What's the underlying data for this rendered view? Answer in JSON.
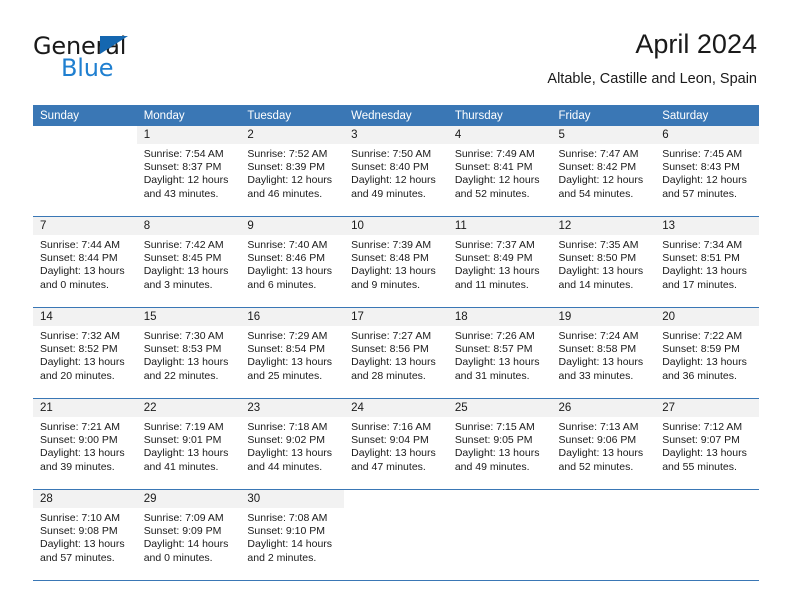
{
  "logo": {
    "word_one": "General",
    "word_two": "Blue",
    "triangle_color": "#1567b0",
    "blue_color": "#1f7fd0"
  },
  "header": {
    "title": "April 2024",
    "subtitle": "Altable, Castille and Leon, Spain"
  },
  "theme": {
    "header_band": "#3a77b5",
    "daynum_band": "#f2f2f2",
    "text": "#1a1a1a"
  },
  "calendar": {
    "weekday_headers": [
      "Sunday",
      "Monday",
      "Tuesday",
      "Wednesday",
      "Thursday",
      "Friday",
      "Saturday"
    ],
    "labels": {
      "sunrise": "Sunrise:",
      "sunset": "Sunset:",
      "daylight": "Daylight:"
    },
    "weeks": [
      [
        {
          "day": "",
          "blank": true
        },
        {
          "day": "1",
          "sunrise": "Sunrise: 7:54 AM",
          "sunset": "Sunset: 8:37 PM",
          "daylight_1": "Daylight: 12 hours",
          "daylight_2": "and 43 minutes."
        },
        {
          "day": "2",
          "sunrise": "Sunrise: 7:52 AM",
          "sunset": "Sunset: 8:39 PM",
          "daylight_1": "Daylight: 12 hours",
          "daylight_2": "and 46 minutes."
        },
        {
          "day": "3",
          "sunrise": "Sunrise: 7:50 AM",
          "sunset": "Sunset: 8:40 PM",
          "daylight_1": "Daylight: 12 hours",
          "daylight_2": "and 49 minutes."
        },
        {
          "day": "4",
          "sunrise": "Sunrise: 7:49 AM",
          "sunset": "Sunset: 8:41 PM",
          "daylight_1": "Daylight: 12 hours",
          "daylight_2": "and 52 minutes."
        },
        {
          "day": "5",
          "sunrise": "Sunrise: 7:47 AM",
          "sunset": "Sunset: 8:42 PM",
          "daylight_1": "Daylight: 12 hours",
          "daylight_2": "and 54 minutes."
        },
        {
          "day": "6",
          "sunrise": "Sunrise: 7:45 AM",
          "sunset": "Sunset: 8:43 PM",
          "daylight_1": "Daylight: 12 hours",
          "daylight_2": "and 57 minutes."
        }
      ],
      [
        {
          "day": "7",
          "sunrise": "Sunrise: 7:44 AM",
          "sunset": "Sunset: 8:44 PM",
          "daylight_1": "Daylight: 13 hours",
          "daylight_2": "and 0 minutes."
        },
        {
          "day": "8",
          "sunrise": "Sunrise: 7:42 AM",
          "sunset": "Sunset: 8:45 PM",
          "daylight_1": "Daylight: 13 hours",
          "daylight_2": "and 3 minutes."
        },
        {
          "day": "9",
          "sunrise": "Sunrise: 7:40 AM",
          "sunset": "Sunset: 8:46 PM",
          "daylight_1": "Daylight: 13 hours",
          "daylight_2": "and 6 minutes."
        },
        {
          "day": "10",
          "sunrise": "Sunrise: 7:39 AM",
          "sunset": "Sunset: 8:48 PM",
          "daylight_1": "Daylight: 13 hours",
          "daylight_2": "and 9 minutes."
        },
        {
          "day": "11",
          "sunrise": "Sunrise: 7:37 AM",
          "sunset": "Sunset: 8:49 PM",
          "daylight_1": "Daylight: 13 hours",
          "daylight_2": "and 11 minutes."
        },
        {
          "day": "12",
          "sunrise": "Sunrise: 7:35 AM",
          "sunset": "Sunset: 8:50 PM",
          "daylight_1": "Daylight: 13 hours",
          "daylight_2": "and 14 minutes."
        },
        {
          "day": "13",
          "sunrise": "Sunrise: 7:34 AM",
          "sunset": "Sunset: 8:51 PM",
          "daylight_1": "Daylight: 13 hours",
          "daylight_2": "and 17 minutes."
        }
      ],
      [
        {
          "day": "14",
          "sunrise": "Sunrise: 7:32 AM",
          "sunset": "Sunset: 8:52 PM",
          "daylight_1": "Daylight: 13 hours",
          "daylight_2": "and 20 minutes."
        },
        {
          "day": "15",
          "sunrise": "Sunrise: 7:30 AM",
          "sunset": "Sunset: 8:53 PM",
          "daylight_1": "Daylight: 13 hours",
          "daylight_2": "and 22 minutes."
        },
        {
          "day": "16",
          "sunrise": "Sunrise: 7:29 AM",
          "sunset": "Sunset: 8:54 PM",
          "daylight_1": "Daylight: 13 hours",
          "daylight_2": "and 25 minutes."
        },
        {
          "day": "17",
          "sunrise": "Sunrise: 7:27 AM",
          "sunset": "Sunset: 8:56 PM",
          "daylight_1": "Daylight: 13 hours",
          "daylight_2": "and 28 minutes."
        },
        {
          "day": "18",
          "sunrise": "Sunrise: 7:26 AM",
          "sunset": "Sunset: 8:57 PM",
          "daylight_1": "Daylight: 13 hours",
          "daylight_2": "and 31 minutes."
        },
        {
          "day": "19",
          "sunrise": "Sunrise: 7:24 AM",
          "sunset": "Sunset: 8:58 PM",
          "daylight_1": "Daylight: 13 hours",
          "daylight_2": "and 33 minutes."
        },
        {
          "day": "20",
          "sunrise": "Sunrise: 7:22 AM",
          "sunset": "Sunset: 8:59 PM",
          "daylight_1": "Daylight: 13 hours",
          "daylight_2": "and 36 minutes."
        }
      ],
      [
        {
          "day": "21",
          "sunrise": "Sunrise: 7:21 AM",
          "sunset": "Sunset: 9:00 PM",
          "daylight_1": "Daylight: 13 hours",
          "daylight_2": "and 39 minutes."
        },
        {
          "day": "22",
          "sunrise": "Sunrise: 7:19 AM",
          "sunset": "Sunset: 9:01 PM",
          "daylight_1": "Daylight: 13 hours",
          "daylight_2": "and 41 minutes."
        },
        {
          "day": "23",
          "sunrise": "Sunrise: 7:18 AM",
          "sunset": "Sunset: 9:02 PM",
          "daylight_1": "Daylight: 13 hours",
          "daylight_2": "and 44 minutes."
        },
        {
          "day": "24",
          "sunrise": "Sunrise: 7:16 AM",
          "sunset": "Sunset: 9:04 PM",
          "daylight_1": "Daylight: 13 hours",
          "daylight_2": "and 47 minutes."
        },
        {
          "day": "25",
          "sunrise": "Sunrise: 7:15 AM",
          "sunset": "Sunset: 9:05 PM",
          "daylight_1": "Daylight: 13 hours",
          "daylight_2": "and 49 minutes."
        },
        {
          "day": "26",
          "sunrise": "Sunrise: 7:13 AM",
          "sunset": "Sunset: 9:06 PM",
          "daylight_1": "Daylight: 13 hours",
          "daylight_2": "and 52 minutes."
        },
        {
          "day": "27",
          "sunrise": "Sunrise: 7:12 AM",
          "sunset": "Sunset: 9:07 PM",
          "daylight_1": "Daylight: 13 hours",
          "daylight_2": "and 55 minutes."
        }
      ],
      [
        {
          "day": "28",
          "sunrise": "Sunrise: 7:10 AM",
          "sunset": "Sunset: 9:08 PM",
          "daylight_1": "Daylight: 13 hours",
          "daylight_2": "and 57 minutes."
        },
        {
          "day": "29",
          "sunrise": "Sunrise: 7:09 AM",
          "sunset": "Sunset: 9:09 PM",
          "daylight_1": "Daylight: 14 hours",
          "daylight_2": "and 0 minutes."
        },
        {
          "day": "30",
          "sunrise": "Sunrise: 7:08 AM",
          "sunset": "Sunset: 9:10 PM",
          "daylight_1": "Daylight: 14 hours",
          "daylight_2": "and 2 minutes."
        },
        {
          "day": "",
          "blank": true
        },
        {
          "day": "",
          "blank": true
        },
        {
          "day": "",
          "blank": true
        },
        {
          "day": "",
          "blank": true
        }
      ]
    ]
  }
}
